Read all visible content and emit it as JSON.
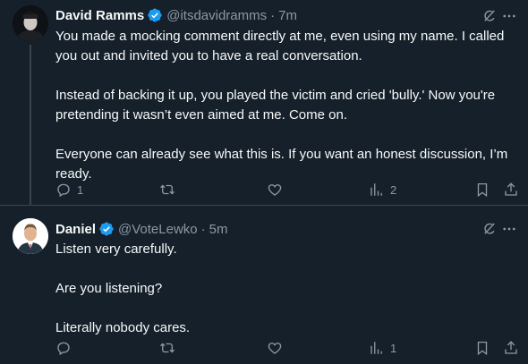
{
  "tweets": [
    {
      "name": "David Ramms",
      "handle": "@itsdavidramms",
      "separator": "·",
      "time": "7m",
      "body": [
        "You made a mocking comment directly at me, even using my name. I called you out and invited you to have a real conversation.",
        "Instead of backing it up, you played the victim and cried 'bully.' Now you're pretending it wasn’t even aimed at me. Come on.",
        "Everyone can already see what this is. If you want an honest discussion, I’m ready."
      ],
      "replies": "1",
      "retweets": "",
      "likes": "",
      "views": "2"
    },
    {
      "name": "Daniel",
      "handle": "@VoteLewko",
      "separator": "·",
      "time": "5m",
      "body": [
        "Listen very carefully.",
        "Are you listening?",
        "Literally nobody cares."
      ],
      "replies": "",
      "retweets": "",
      "likes": "",
      "views": "1"
    }
  ],
  "colors": {
    "background": "#15202b",
    "text": "#f7f9f9",
    "secondary_text": "#8b98a5",
    "verified_badge": "#1d9bf0",
    "divider": "#38444d"
  },
  "icons": [
    "verified-badge-icon",
    "grok-icon",
    "more-icon",
    "reply-icon",
    "retweet-icon",
    "like-icon",
    "views-icon",
    "bookmark-icon",
    "share-icon"
  ]
}
